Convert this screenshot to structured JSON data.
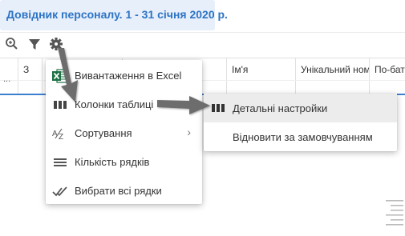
{
  "header": {
    "title": "Довідник персоналу. 1 - 31 січня 2020 р."
  },
  "toolbar": {
    "icons": [
      "zoom-icon",
      "filter-icon",
      "gear-icon"
    ]
  },
  "grid": {
    "columns": [
      "",
      "З",
      "",
      "",
      "Ім'я",
      "Унікальний ном",
      "По-бат"
    ],
    "row_marker": "..."
  },
  "menu": {
    "items": [
      {
        "label": "Вивантаження в Excel",
        "icon": "excel-icon"
      },
      {
        "label": "Колонки таблиці",
        "icon": "columns-icon"
      },
      {
        "label": "Сортування",
        "icon": "sort-az-icon",
        "submenu_indicator": "›"
      },
      {
        "label": "Кількість рядків",
        "icon": "rows-icon"
      },
      {
        "label": "Вибрати всі рядки",
        "icon": "double-check-icon"
      }
    ]
  },
  "submenu": {
    "items": [
      {
        "label": "Детальні настройки",
        "icon": "columns-icon"
      },
      {
        "label": "Відновити за замовчуванням"
      }
    ]
  },
  "colors": {
    "accent": "#2d74c4",
    "title_bg": "#e7effb",
    "grid_line": "#3b7fce",
    "excel_green": "#1e7145",
    "arrow_gray": "#6d6d6d"
  }
}
